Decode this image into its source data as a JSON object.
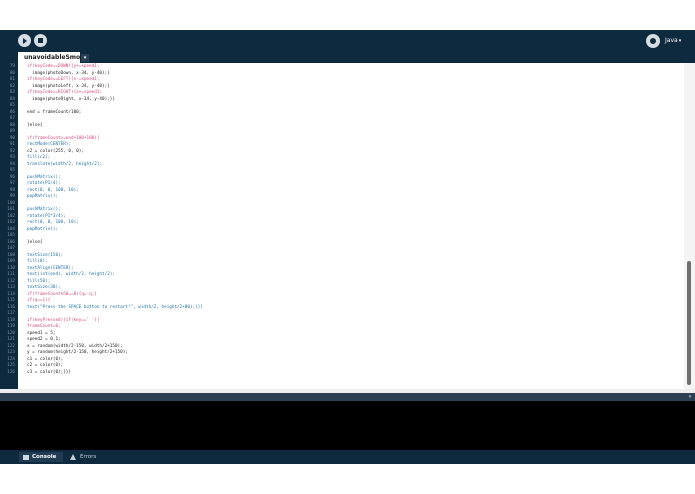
{
  "toolbar": {
    "run_label": "Run",
    "stop_label": "Stop",
    "mode": "Java",
    "mode_arrow": "▾"
  },
  "tab": {
    "name": "unavoidableSmog",
    "menu_glyph": "▾"
  },
  "editor": {
    "lines": [
      {
        "num": "79",
        "segments": [
          {
            "t": "if(keyCode==DOWN){y+=speed1;",
            "c": "#d24b7e"
          }
        ]
      },
      {
        "num": "80",
        "segments": [
          {
            "t": "  image(photoDown, x-34, y-40);}",
            "c": "#222222"
          }
        ]
      },
      {
        "num": "81",
        "segments": [
          {
            "t": "if(keyCode==LEFT){x-=speed1;",
            "c": "#d24b7e"
          }
        ]
      },
      {
        "num": "82",
        "segments": [
          {
            "t": "  image(photoLeft, x-34, y-40);}",
            "c": "#222222"
          }
        ]
      },
      {
        "num": "83",
        "segments": [
          {
            "t": "if(keyCode==RIGHT){x+=speed1;",
            "c": "#d24b7e"
          }
        ]
      },
      {
        "num": "84",
        "segments": [
          {
            "t": "  image(photoRight, x-34, y-40);}}",
            "c": "#222222"
          }
        ]
      },
      {
        "num": "85",
        "segments": [
          {
            "t": "",
            "c": "#222222"
          }
        ]
      },
      {
        "num": "86",
        "segments": [
          {
            "t": "end = frameCount/100;",
            "c": "#222222"
          }
        ]
      },
      {
        "num": "87",
        "segments": [
          {
            "t": "",
            "c": "#222222"
          }
        ]
      },
      {
        "num": "88",
        "segments": [
          {
            "t": "}else{",
            "c": "#222222"
          }
        ]
      },
      {
        "num": "89",
        "segments": [
          {
            "t": "",
            "c": "#222222"
          }
        ]
      },
      {
        "num": "90",
        "segments": [
          {
            "t": "if(frameCount>=end+100+100){",
            "c": "#d24b7e"
          }
        ]
      },
      {
        "num": "91",
        "segments": [
          {
            "t": "rectMode(CENTER);",
            "c": "#1f6fa8"
          }
        ]
      },
      {
        "num": "92",
        "segments": [
          {
            "t": "c2 = color(255, 0, 0);",
            "c": "#222222"
          }
        ]
      },
      {
        "num": "93",
        "segments": [
          {
            "t": "fill(c2);",
            "c": "#1f6fa8"
          }
        ]
      },
      {
        "num": "94",
        "segments": [
          {
            "t": "translate(width/2, height/2);",
            "c": "#1f6fa8"
          }
        ]
      },
      {
        "num": "95",
        "segments": [
          {
            "t": "",
            "c": "#222222"
          }
        ]
      },
      {
        "num": "96",
        "segments": [
          {
            "t": "pushMatrix();",
            "c": "#1f6fa8"
          }
        ]
      },
      {
        "num": "97",
        "segments": [
          {
            "t": "rotate(PI/4);",
            "c": "#1f6fa8"
          }
        ]
      },
      {
        "num": "98",
        "segments": [
          {
            "t": "rect(0, 0, 100, 10);",
            "c": "#1f6fa8"
          }
        ]
      },
      {
        "num": "99",
        "segments": [
          {
            "t": "popMatrix();",
            "c": "#1f6fa8"
          }
        ]
      },
      {
        "num": "100",
        "segments": [
          {
            "t": "",
            "c": "#222222"
          }
        ]
      },
      {
        "num": "101",
        "segments": [
          {
            "t": "pushMatrix();",
            "c": "#1f6fa8"
          }
        ]
      },
      {
        "num": "102",
        "segments": [
          {
            "t": "rotate(PI*3/4);",
            "c": "#1f6fa8"
          }
        ]
      },
      {
        "num": "103",
        "segments": [
          {
            "t": "rect(0, 0, 100, 10);",
            "c": "#1f6fa8"
          }
        ]
      },
      {
        "num": "104",
        "segments": [
          {
            "t": "popMatrix();",
            "c": "#1f6fa8"
          }
        ]
      },
      {
        "num": "105",
        "segments": [
          {
            "t": "",
            "c": "#222222"
          }
        ]
      },
      {
        "num": "106",
        "segments": [
          {
            "t": "}else{",
            "c": "#222222"
          }
        ]
      },
      {
        "num": "107",
        "segments": [
          {
            "t": "",
            "c": "#222222"
          }
        ]
      },
      {
        "num": "108",
        "segments": [
          {
            "t": "textSize(150);",
            "c": "#1f6fa8"
          }
        ]
      },
      {
        "num": "109",
        "segments": [
          {
            "t": "fill(0);",
            "c": "#1f6fa8"
          }
        ]
      },
      {
        "num": "110",
        "segments": [
          {
            "t": "textAlign(CENTER);",
            "c": "#1f6fa8"
          }
        ]
      },
      {
        "num": "111",
        "segments": [
          {
            "t": "text(int(end), width/2, height/2);",
            "c": "#1f6fa8"
          }
        ]
      },
      {
        "num": "112",
        "segments": [
          {
            "t": "fill(50);",
            "c": "#1f6fa8"
          }
        ]
      },
      {
        "num": "113",
        "segments": [
          {
            "t": "textSize(30);",
            "c": "#1f6fa8"
          }
        ]
      },
      {
        "num": "114",
        "segments": [
          {
            "t": "if(frameCount%50==0){q=-q;}",
            "c": "#d24b7e"
          }
        ]
      },
      {
        "num": "115",
        "segments": [
          {
            "t": "if(q==1){",
            "c": "#d24b7e"
          }
        ]
      },
      {
        "num": "116",
        "segments": [
          {
            "t": "text(\"Press the SPACE button to restart!\", width/2, height/2+80);}}}",
            "c": "#1f6fa8"
          }
        ]
      },
      {
        "num": "117",
        "segments": [
          {
            "t": "",
            "c": "#222222"
          }
        ]
      },
      {
        "num": "118",
        "segments": [
          {
            "t": "if(keyPressed){if(key==' '){",
            "c": "#d24b7e"
          }
        ]
      },
      {
        "num": "119",
        "segments": [
          {
            "t": "frameCount=0;",
            "c": "#d24b7e"
          }
        ]
      },
      {
        "num": "120",
        "segments": [
          {
            "t": "speed1 = 5;",
            "c": "#222222"
          }
        ]
      },
      {
        "num": "121",
        "segments": [
          {
            "t": "speed2 = 0.1;",
            "c": "#222222"
          }
        ]
      },
      {
        "num": "122",
        "segments": [
          {
            "t": "x = random(width/2-150, width/2+150);",
            "c": "#222222"
          }
        ]
      },
      {
        "num": "123",
        "segments": [
          {
            "t": "y = random(height/2-150, height/2+150);",
            "c": "#222222"
          }
        ]
      },
      {
        "num": "124",
        "segments": [
          {
            "t": "c1 = color(0);",
            "c": "#222222"
          }
        ]
      },
      {
        "num": "125",
        "segments": [
          {
            "t": "c2 = color(0);",
            "c": "#222222"
          }
        ]
      },
      {
        "num": "126",
        "segments": [
          {
            "t": "c3 = color(0);}}}",
            "c": "#222222"
          }
        ]
      }
    ]
  },
  "bottom_panel": {
    "tabs": [
      {
        "label": "Console",
        "icon": "console-icon"
      },
      {
        "label": "Errors",
        "icon": "warning-icon"
      }
    ]
  },
  "colors": {
    "chrome": "#0e2a3e",
    "keyword": "#d24b7e",
    "function": "#1f6fa8",
    "text": "#222222"
  }
}
